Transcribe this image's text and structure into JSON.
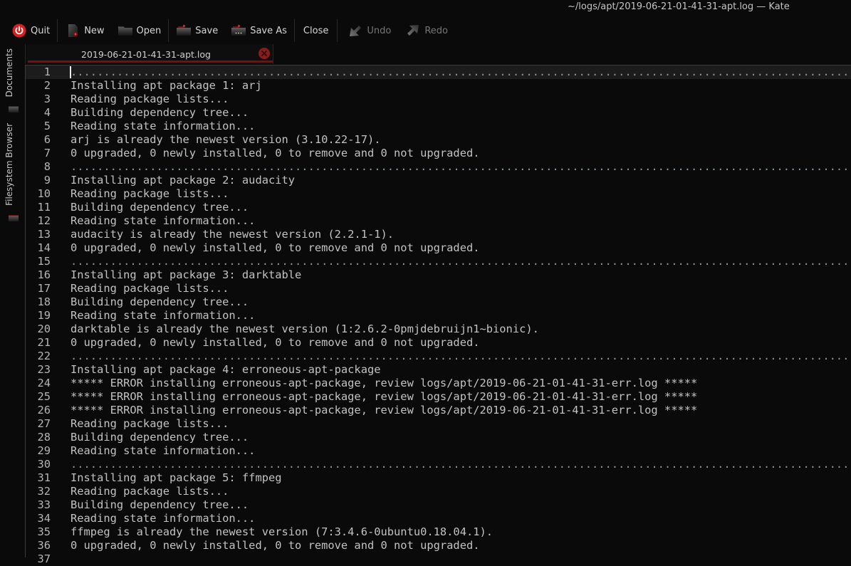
{
  "window": {
    "title": "~/logs/apt/2019-06-21-01-41-31-apt.log — Kate"
  },
  "toolbar": {
    "quit": "Quit",
    "new": "New",
    "open": "Open",
    "save": "Save",
    "save_as": "Save As",
    "close": "Close",
    "undo": "Undo",
    "redo": "Redo"
  },
  "sidebar": {
    "documents": "Documents",
    "filesystem_browser": "Filesystem Browser"
  },
  "tabs": [
    {
      "label": "2019-06-21-01-41-31-apt.log",
      "active": true
    }
  ],
  "colors": {
    "accent": "#7d0c0c",
    "close_badge": "#8b1c1c",
    "quit_icon": "#d32020"
  },
  "editor": {
    "current_line": 1,
    "lines": [
      {
        "n": "1",
        "text": "......................................................................................................................",
        "dots": true
      },
      {
        "n": "2",
        "text": "Installing apt package 1: arj"
      },
      {
        "n": "3",
        "text": "Reading package lists..."
      },
      {
        "n": "4",
        "text": "Building dependency tree..."
      },
      {
        "n": "5",
        "text": "Reading state information..."
      },
      {
        "n": "6",
        "text": "arj is already the newest version (3.10.22-17)."
      },
      {
        "n": "7",
        "text": "0 upgraded, 0 newly installed, 0 to remove and 0 not upgraded."
      },
      {
        "n": "8",
        "text": "......................................................................................................................",
        "dots": true
      },
      {
        "n": "9",
        "text": "Installing apt package 2: audacity"
      },
      {
        "n": "10",
        "text": "Reading package lists..."
      },
      {
        "n": "11",
        "text": "Building dependency tree..."
      },
      {
        "n": "12",
        "text": "Reading state information..."
      },
      {
        "n": "13",
        "text": "audacity is already the newest version (2.2.1-1)."
      },
      {
        "n": "14",
        "text": "0 upgraded, 0 newly installed, 0 to remove and 0 not upgraded."
      },
      {
        "n": "15",
        "text": "......................................................................................................................",
        "dots": true
      },
      {
        "n": "16",
        "text": "Installing apt package 3: darktable"
      },
      {
        "n": "17",
        "text": "Reading package lists..."
      },
      {
        "n": "18",
        "text": "Building dependency tree..."
      },
      {
        "n": "19",
        "text": "Reading state information..."
      },
      {
        "n": "20",
        "text": "darktable is already the newest version (1:2.6.2-0pmjdebruijn1~bionic)."
      },
      {
        "n": "21",
        "text": "0 upgraded, 0 newly installed, 0 to remove and 0 not upgraded."
      },
      {
        "n": "22",
        "text": "......................................................................................................................",
        "dots": true
      },
      {
        "n": "23",
        "text": "Installing apt package 4: erroneous-apt-package"
      },
      {
        "n": "24",
        "text": "***** ERROR installing erroneous-apt-package, review logs/apt/2019-06-21-01-41-31-err.log *****"
      },
      {
        "n": "25",
        "text": "***** ERROR installing erroneous-apt-package, review logs/apt/2019-06-21-01-41-31-err.log *****"
      },
      {
        "n": "26",
        "text": "***** ERROR installing erroneous-apt-package, review logs/apt/2019-06-21-01-41-31-err.log *****"
      },
      {
        "n": "27",
        "text": "Reading package lists..."
      },
      {
        "n": "28",
        "text": "Building dependency tree..."
      },
      {
        "n": "29",
        "text": "Reading state information..."
      },
      {
        "n": "30",
        "text": "......................................................................................................................",
        "dots": true
      },
      {
        "n": "31",
        "text": "Installing apt package 5: ffmpeg"
      },
      {
        "n": "32",
        "text": "Reading package lists..."
      },
      {
        "n": "33",
        "text": "Building dependency tree..."
      },
      {
        "n": "34",
        "text": "Reading state information..."
      },
      {
        "n": "35",
        "text": "ffmpeg is already the newest version (7:3.4.6-0ubuntu0.18.04.1)."
      },
      {
        "n": "36",
        "text": "0 upgraded, 0 newly installed, 0 to remove and 0 not upgraded."
      },
      {
        "n": "37",
        "text": ""
      }
    ]
  }
}
